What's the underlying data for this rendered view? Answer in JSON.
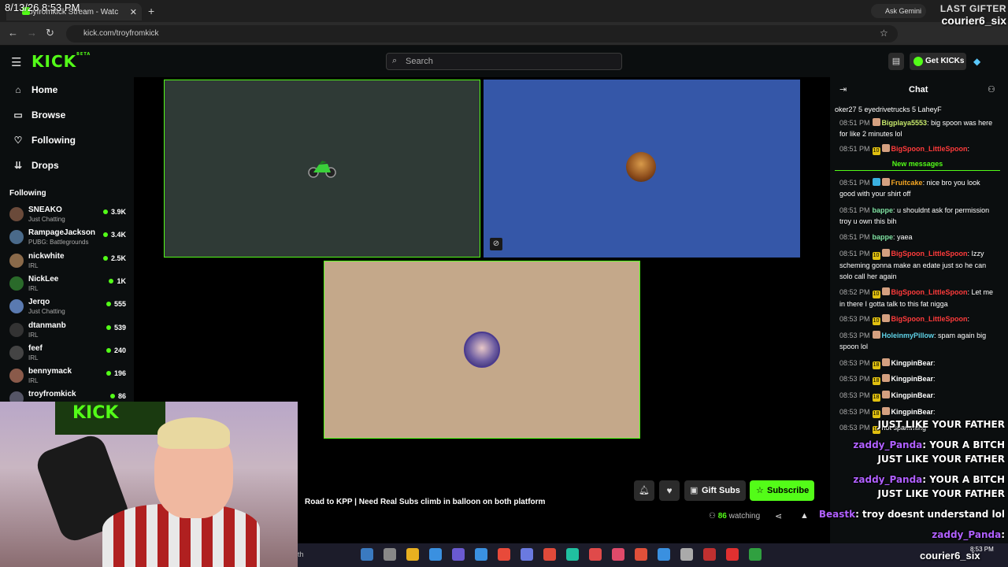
{
  "overlay": {
    "timestamp": "8/13/26 8:53 PM",
    "last_gifter_title": "LAST GIFTER",
    "last_gifter_name": "courier6_six",
    "taskbar_gifter": "courier6_six",
    "taskbar_time": "8:53 PM"
  },
  "browser": {
    "tab_title": "troyfromkick Stream - Watc",
    "url": "kick.com/troyfromkick",
    "gemini": "Ask Gemini"
  },
  "header": {
    "logo": "KICK",
    "logo_beta": "BETA",
    "search_placeholder": "Search",
    "get_kicks": "Get KICKs"
  },
  "sidebar": {
    "nav": [
      {
        "label": "Home",
        "icon": "home-icon"
      },
      {
        "label": "Browse",
        "icon": "browse-icon"
      },
      {
        "label": "Following",
        "icon": "heart-icon"
      },
      {
        "label": "Drops",
        "icon": "drops-icon"
      }
    ],
    "following_header": "Following",
    "channels": [
      {
        "name": "SNEAKO",
        "category": "Just Chatting",
        "viewers": "3.9K"
      },
      {
        "name": "RampageJackson",
        "category": "PUBG: Battlegrounds",
        "viewers": "3.4K"
      },
      {
        "name": "nickwhite",
        "category": "IRL",
        "viewers": "2.5K"
      },
      {
        "name": "NickLee",
        "category": "IRL",
        "viewers": "1K"
      },
      {
        "name": "Jerqo",
        "category": "Just Chatting",
        "viewers": "555"
      },
      {
        "name": "dtanmanb",
        "category": "IRL",
        "viewers": "539"
      },
      {
        "name": "feef",
        "category": "IRL",
        "viewers": "240"
      },
      {
        "name": "bennymack",
        "category": "IRL",
        "viewers": "196"
      },
      {
        "name": "troyfromkick",
        "category": "",
        "viewers": "86"
      }
    ]
  },
  "stream": {
    "title": "Road to KPP | Need Real Subs climb in balloon on both platform",
    "viewers": "86",
    "watching_label": "watching",
    "gift_subs": "Gift Subs",
    "subscribe": "Subscribe"
  },
  "webcam": {
    "banner_text": "KICK"
  },
  "chat": {
    "title": "Chat",
    "gifter_strip": "oker27 5   eyedrivetrucks 5   LaheyF",
    "new_messages": "New messages",
    "messages": [
      {
        "time": "08:51 PM",
        "user": "Bigplaya5553",
        "color": "#c7e86b",
        "text": ": big spoon was here for like 2 minutes lol",
        "badges": [
          "b3"
        ]
      },
      {
        "time": "08:51 PM",
        "user": "BigSpoon_LittleSpoon",
        "color": "#ff3b3b",
        "text": ":",
        "badges": [
          "10",
          "b3"
        ]
      },
      {
        "time": "08:51 PM",
        "user": "Fruitcake",
        "color": "#f5a623",
        "text": ": nice bro you look good with your shirt off",
        "badges": [
          "b2",
          "b3"
        ]
      },
      {
        "time": "08:51 PM",
        "user": "bappe",
        "color": "#7ee0a0",
        "text": ": u shouldnt ask for permission troy u own this bih",
        "badges": []
      },
      {
        "time": "08:51 PM",
        "user": "bappe",
        "color": "#7ee0a0",
        "text": ": yaea",
        "badges": []
      },
      {
        "time": "08:51 PM",
        "user": "BigSpoon_LittleSpoon",
        "color": "#ff3b3b",
        "text": ": Izzy scheming gonna make an edate just so he can solo call her again",
        "badges": [
          "10",
          "b3"
        ]
      },
      {
        "time": "08:52 PM",
        "user": "BigSpoon_LittleSpoon",
        "color": "#ff3b3b",
        "text": ": Let me in there I gotta talk to this fat nigga",
        "badges": [
          "10",
          "b3"
        ]
      },
      {
        "time": "08:53 PM",
        "user": "BigSpoon_LittleSpoon",
        "color": "#ff3b3b",
        "text": ":",
        "badges": [
          "10",
          "b3"
        ]
      },
      {
        "time": "08:53 PM",
        "user": "HoleinmyPillow",
        "color": "#5fd3e8",
        "text": ": spam again big spoon lol",
        "badges": [
          "b3"
        ]
      },
      {
        "time": "08:53 PM",
        "user": "KingpinBear",
        "color": "#ffffff",
        "text": ":",
        "badges": [
          "18",
          "b3"
        ]
      },
      {
        "time": "08:53 PM",
        "user": "KingpinBear",
        "color": "#ffffff",
        "text": ":",
        "badges": [
          "18",
          "b3"
        ]
      },
      {
        "time": "08:53 PM",
        "user": "KingpinBear",
        "color": "#ffffff",
        "text": ":",
        "badges": [
          "18",
          "b3"
        ]
      },
      {
        "time": "08:53 PM",
        "user": "KingpinBear",
        "color": "#ffffff",
        "text": ":",
        "badges": [
          "18",
          "b3"
        ]
      },
      {
        "time": "08:53 PM",
        "user": "",
        "color": "#ffffff",
        "text": "not spamming",
        "badges": [
          "10"
        ]
      }
    ],
    "overlay_lines": [
      {
        "user": "",
        "text": "JUST LIKE YOUR FATHER"
      },
      {
        "user": "zaddy_Panda",
        "text": ": YOUR A BITCH"
      },
      {
        "user": "",
        "text": "JUST LIKE YOUR FATHER"
      },
      {
        "user": "zaddy_Panda",
        "text": ": YOUR A BITCH"
      },
      {
        "user": "",
        "text": "JUST LIKE YOUR FATHER"
      },
      {
        "user": "Beastk",
        "text": ": troy doesnt understand lol"
      },
      {
        "user": "zaddy_Panda",
        "text": ":"
      }
    ]
  }
}
